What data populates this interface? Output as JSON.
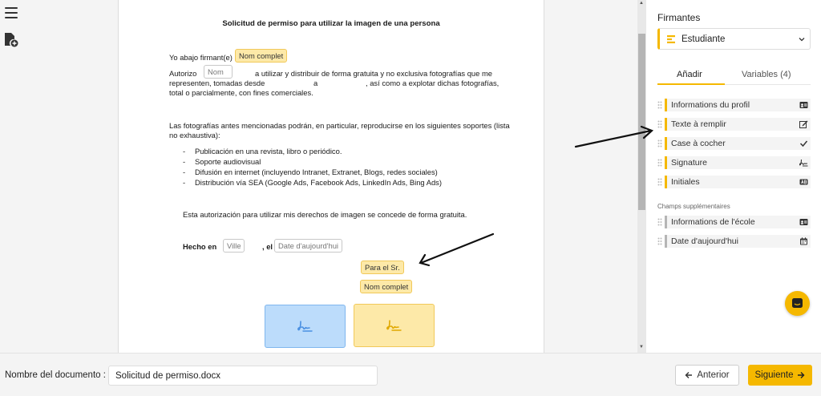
{
  "document": {
    "title": "Solicitud de permiso para utilizar la imagen de una persona",
    "l1_prefix": "Yo abajo firmant(e) :",
    "f_nombre_completo": "Nom complet",
    "l2_prefix": "Autorizo",
    "f_nom": "Nom",
    "l2_suffix": "a utilizar y distribuir de forma gratuita y no exclusiva fotografías que me",
    "l3_prefix": "representen, tomadas desde",
    "l3_a": "a",
    "l3_suffix": ", así como a explotar dichas fotografías,",
    "l4": "total o parcialmente, con fines comerciales.",
    "p2_l1": "Las fotografías antes mencionadas podrán, en particular, reproducirse en los siguientes soportes (lista",
    "p2_l2": "no exhaustiva):",
    "bullet_mark": "-",
    "bullets": [
      "Publicación en una revista, libro o periódico.",
      "Soporte audiovisual",
      "Difusión en internet (incluyendo Intranet, Extranet, Blogs, redes sociales)",
      "Distribución vía SEA (Google Ads, Facebook Ads, LinkedIn Ads, Bing Ads)"
    ],
    "p3": "Esta autorización para utilizar mis derechos de imagen se concede de forma gratuita.",
    "hecho_en": "Hecho en",
    "f_ville": "Ville",
    "el": ", el",
    "f_date": "Date d'aujourd'hui",
    "f_para": "Para el Sr.",
    "f_nombre_completo2": "Nom complet"
  },
  "sidebar": {
    "title": "Firmantes",
    "signer": "Estudiante",
    "tabs": [
      "Añadir",
      "Variables (4)"
    ],
    "items": [
      {
        "label": "Informations du profil",
        "icon": "id-card-icon"
      },
      {
        "label": "Texte à remplir",
        "icon": "edit-icon"
      },
      {
        "label": "Case à cocher",
        "icon": "check-icon"
      },
      {
        "label": "Signature",
        "icon": "signature-icon"
      },
      {
        "label": "Initiales",
        "icon": "initials-icon"
      }
    ],
    "extra_header": "Champs supplémentaires",
    "extra_items": [
      {
        "label": "Informations de l'école",
        "icon": "id-card-icon"
      },
      {
        "label": "Date d'aujourd'hui",
        "icon": "calendar-icon"
      }
    ]
  },
  "footer": {
    "doc_name_label": "Nombre del documento :",
    "doc_name_value": "Solicitud de permiso.docx",
    "prev_label": "Anterior",
    "next_label": "Siguiente"
  },
  "colors": {
    "accent": "#f5b800",
    "field_yellow": "#fde9a8",
    "field_blue": "#bcdcfb"
  }
}
